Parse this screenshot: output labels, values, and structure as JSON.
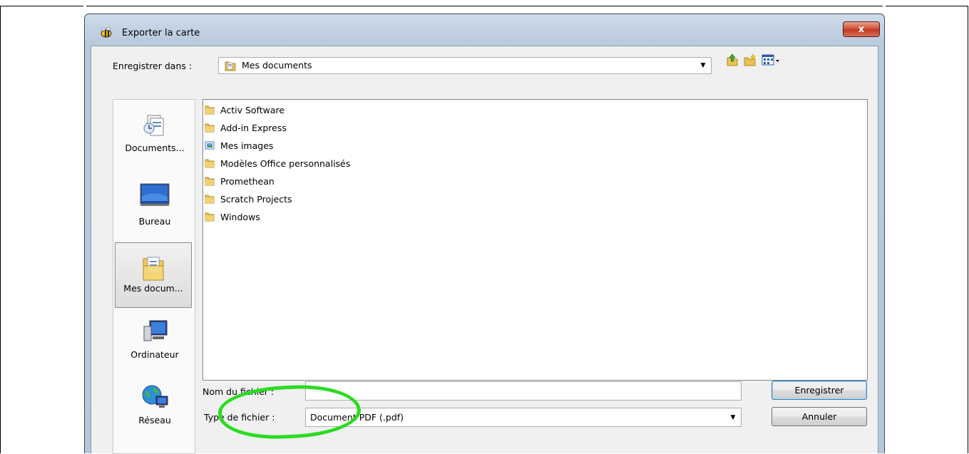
{
  "window": {
    "title": "Exporter la carte",
    "close_label": "x"
  },
  "toolbar": {
    "save_in_label": "Enregistrer dans :",
    "location": "Mes documents",
    "icons": [
      "up-folder-icon",
      "new-folder-icon",
      "view-menu-icon"
    ]
  },
  "places": [
    {
      "label": "Documents...",
      "icon": "recent-documents-icon"
    },
    {
      "label": "Bureau",
      "icon": "desktop-icon"
    },
    {
      "label": "Mes docum...",
      "icon": "my-documents-icon",
      "selected": true
    },
    {
      "label": "Ordinateur",
      "icon": "computer-icon"
    },
    {
      "label": "Réseau",
      "icon": "network-icon"
    }
  ],
  "files": [
    {
      "name": "Activ Software",
      "icon": "folder-icon"
    },
    {
      "name": "Add-in Express",
      "icon": "folder-icon"
    },
    {
      "name": "Mes images",
      "icon": "pictures-folder-icon"
    },
    {
      "name": "Modèles Office personnalisés",
      "icon": "folder-icon"
    },
    {
      "name": "Promethean",
      "icon": "folder-icon"
    },
    {
      "name": "Scratch Projects",
      "icon": "folder-icon"
    },
    {
      "name": "Windows",
      "icon": "folder-icon"
    }
  ],
  "form": {
    "filename_label": "Nom du fichier :",
    "filename_value": "",
    "filetype_label": "Type de fichier :",
    "filetype_value": "Document PDF (.pdf)"
  },
  "buttons": {
    "save": "Enregistrer",
    "cancel": "Annuler"
  },
  "colors": {
    "annotation": "#2bdc21",
    "close_button": "#c23a22"
  }
}
